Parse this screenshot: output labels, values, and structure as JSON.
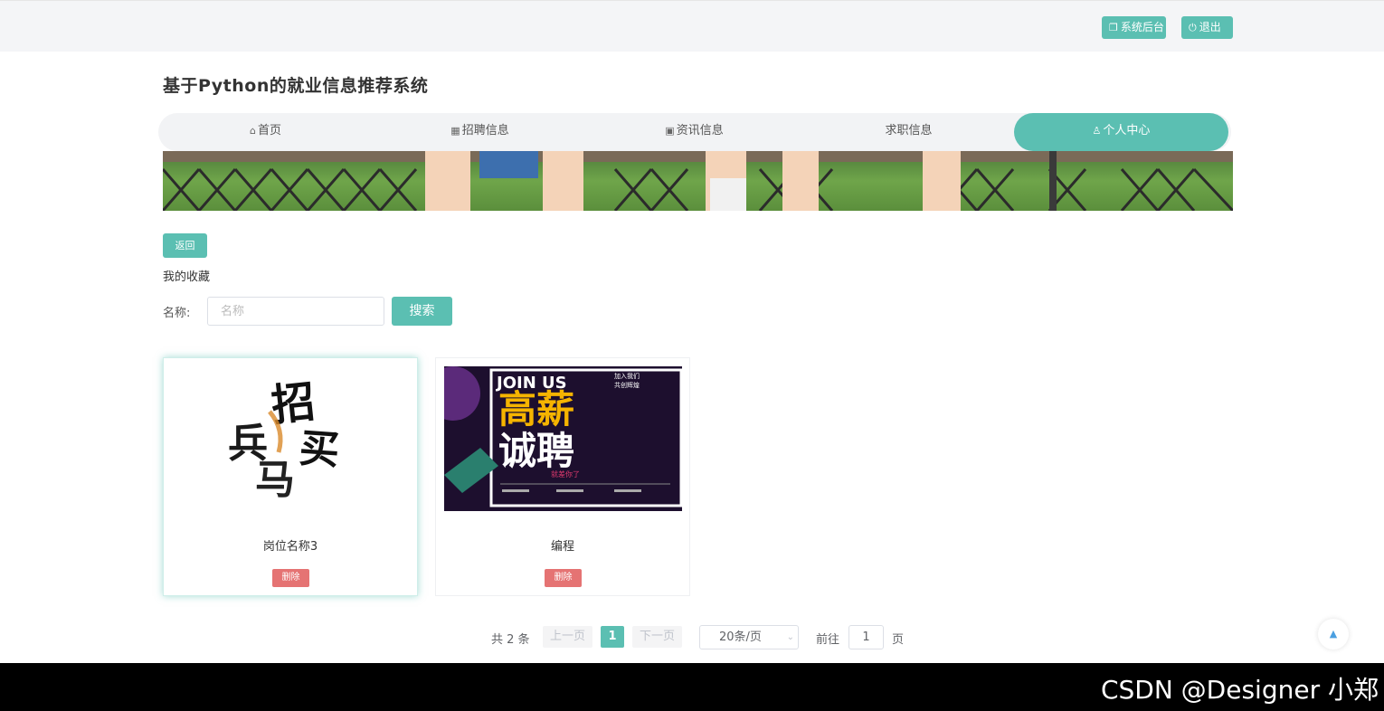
{
  "header": {
    "admin_button": "系统后台",
    "logout_button": "退出"
  },
  "site": {
    "title": "基于Python的就业信息推荐系统"
  },
  "nav": {
    "items": [
      {
        "label": "首页",
        "icon": "home-icon"
      },
      {
        "label": "招聘信息",
        "icon": "grid-icon"
      },
      {
        "label": "资讯信息",
        "icon": "briefcase-icon"
      },
      {
        "label": "求职信息",
        "icon": ""
      },
      {
        "label": "个人中心",
        "icon": "user-icon",
        "active": true
      }
    ]
  },
  "page": {
    "back_button": "返回",
    "section_title": "我的收藏",
    "search": {
      "label": "名称:",
      "placeholder": "名称",
      "value": "",
      "button": "搜索"
    }
  },
  "cards": [
    {
      "name": "岗位名称3",
      "delete_label": "删除",
      "poster_text": "招兵买马"
    },
    {
      "name": "编程",
      "delete_label": "删除",
      "poster_text": {
        "top": "JOIN US",
        "side": "加入我们 共创辉煌",
        "main1": "高薪",
        "main2": "诚聘",
        "sub": "就差你了"
      }
    }
  ],
  "pagination": {
    "total": "共 2 条",
    "prev": "上一页",
    "current": "1",
    "next": "下一页",
    "page_size": "20条/页",
    "goto_label": "前往",
    "goto_value": "1",
    "unit": "页"
  },
  "watermark": "CSDN @Designer 小郑",
  "colors": {
    "accent": "#5bbfb2",
    "danger": "#e57373"
  }
}
